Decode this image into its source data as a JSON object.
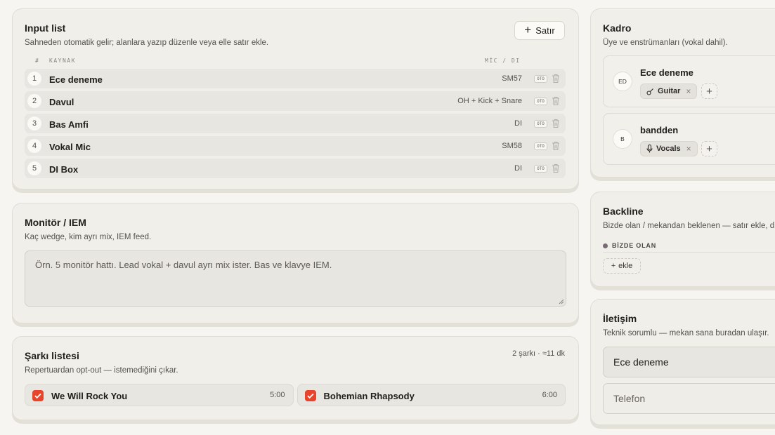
{
  "input_list": {
    "title": "Input list",
    "subtitle": "Sahneden otomatik gelir; alanlara yazıp düzenle veya elle satır ekle.",
    "add_label": "Satır",
    "col_num": "#",
    "col_source": "KAYNAK",
    "col_mic": "MİC / DI",
    "auto_badge": "OTO",
    "rows": [
      {
        "num": "1",
        "source": "Ece deneme",
        "mic": "SM57"
      },
      {
        "num": "2",
        "source": "Davul",
        "mic": "OH + Kick + Snare"
      },
      {
        "num": "3",
        "source": "Bas Amfi",
        "mic": "DI"
      },
      {
        "num": "4",
        "source": "Vokal Mic",
        "mic": "SM58"
      },
      {
        "num": "5",
        "source": "DI Box",
        "mic": "DI"
      }
    ]
  },
  "monitor": {
    "title": "Monitör / IEM",
    "subtitle": "Kaç wedge, kim ayrı mix, IEM feed.",
    "placeholder": "Örn. 5 monitör hattı. Lead vokal + davul ayrı mix ister. Bas ve klavye IEM."
  },
  "songs": {
    "title": "Şarkı listesi",
    "subtitle": "Repertuardan opt-out — istemediğini çıkar.",
    "meta": "2 şarkı · ≈11 dk",
    "items": [
      {
        "title": "We Will Rock You",
        "duration": "5:00",
        "checked": true
      },
      {
        "title": "Bohemian Rhapsody",
        "duration": "6:00",
        "checked": true
      }
    ]
  },
  "kadro": {
    "title": "Kadro",
    "subtitle": "Üye ve enstrümanları (vokal dahil).",
    "members": [
      {
        "initials": "ED",
        "name": "Ece deneme",
        "instrument": "Guitar",
        "icon": "guitar-icon"
      },
      {
        "initials": "B",
        "name": "bandden",
        "instrument": "Vocals",
        "icon": "mic-icon"
      }
    ]
  },
  "backline": {
    "title": "Backline",
    "subtitle": "Bizde olan / mekandan beklenen — satır ekle, dü",
    "section_label": "BİZDE OLAN",
    "add_label": "ekle"
  },
  "contact": {
    "title": "İletişim",
    "subtitle": "Teknik sorumlu — mekan sana buradan ulaşır.",
    "name_value": "Ece deneme",
    "phone_placeholder": "Telefon"
  },
  "colors": {
    "accent": "#e8442c",
    "card_bg": "#f1efea",
    "page_bg": "#f6f5f1"
  }
}
